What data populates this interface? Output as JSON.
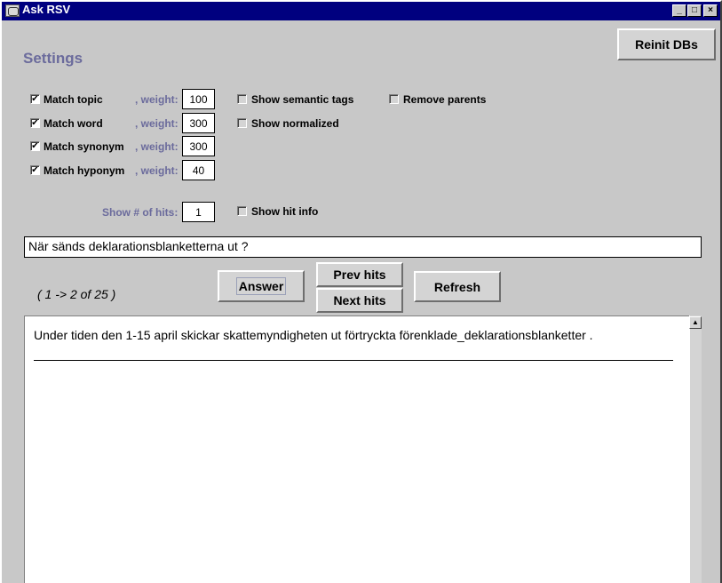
{
  "window": {
    "title": "Ask RSV",
    "minimize_glyph": "_",
    "maximize_glyph": "□",
    "close_glyph": "×"
  },
  "header": {
    "reinit_button": "Reinit DBs",
    "settings_heading": "Settings"
  },
  "matches": [
    {
      "label": "Match topic",
      "checked": true,
      "weight_label": ", weight:",
      "weight": "100"
    },
    {
      "label": "Match word",
      "checked": true,
      "weight_label": ", weight:",
      "weight": "300"
    },
    {
      "label": "Match synonym",
      "checked": true,
      "weight_label": ", weight:",
      "weight": "300"
    },
    {
      "label": "Match hyponym",
      "checked": true,
      "weight_label": ", weight:",
      "weight": "40"
    }
  ],
  "options": {
    "show_semantic_tags": {
      "label": "Show semantic tags",
      "checked": false
    },
    "remove_parents": {
      "label": "Remove parents",
      "checked": false
    },
    "show_normalized": {
      "label": "Show normalized",
      "checked": false
    },
    "show_hit_info": {
      "label": "Show hit info",
      "checked": false
    }
  },
  "hits": {
    "label": "Show # of hits:",
    "value": "1"
  },
  "query": {
    "value": "När sänds deklarationsblanketterna ut ?"
  },
  "actions": {
    "range_text": "( 1 -> 2 of 25 )",
    "answer": "Answer",
    "prev_hits": "Prev hits",
    "next_hits": "Next hits",
    "refresh": "Refresh"
  },
  "result": {
    "text": "Under tiden den 1-15 april skickar skattemyndigheten ut förtryckta förenklade_deklarationsblanketter ."
  },
  "icons": {
    "app": "java-cup-icon",
    "check_glyph": "✔",
    "scroll_up_glyph": "▲"
  }
}
